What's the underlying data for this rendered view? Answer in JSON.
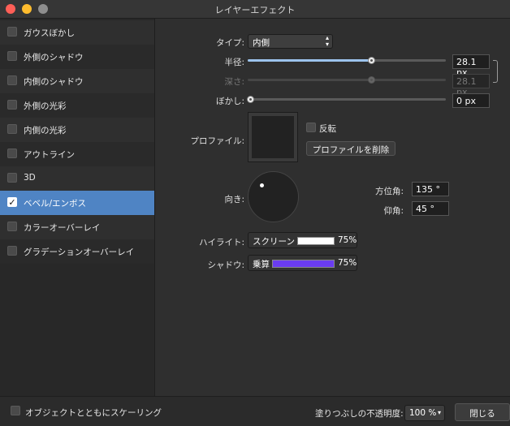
{
  "window": {
    "title": "レイヤーエフェクト"
  },
  "sidebar": {
    "items": [
      {
        "label": "ガウスぼかし",
        "checked": false
      },
      {
        "label": "外側のシャドウ",
        "checked": false
      },
      {
        "label": "内側のシャドウ",
        "checked": false
      },
      {
        "label": "外側の光彩",
        "checked": false
      },
      {
        "label": "内側の光彩",
        "checked": false
      },
      {
        "label": "アウトライン",
        "checked": false
      },
      {
        "label": "3D",
        "checked": false
      },
      {
        "label": "ベベル/エンボス",
        "checked": true
      },
      {
        "label": "カラーオーバーレイ",
        "checked": false
      },
      {
        "label": "グラデーションオーバーレイ",
        "checked": false
      }
    ]
  },
  "settings": {
    "type_label": "タイプ:",
    "type_value": "内側",
    "radius_label": "半径:",
    "radius_value": "28.1 px",
    "radius_fraction": 0.62,
    "depth_label": "深さ:",
    "depth_value": "28.1 px",
    "depth_fraction": 0.62,
    "blur_label": "ぼかし:",
    "blur_value": "0 px",
    "blur_fraction": 0.0,
    "profile_label": "プロファイル:",
    "invert_label": "反転",
    "delete_profile_label": "プロファイルを削除",
    "direction_label": "向き:",
    "azimuth_label": "方位角:",
    "azimuth_value": "135 °",
    "elevation_label": "仰角:",
    "elevation_value": "45 °",
    "highlight_label": "ハイライト:",
    "highlight_mode": "スクリーン",
    "highlight_color": "#ffffff",
    "highlight_opacity": "75%",
    "shadow_label": "シャドウ:",
    "shadow_mode": "乗算",
    "shadow_color": "#6a3cf0",
    "shadow_opacity": "75%"
  },
  "footer": {
    "scale_label": "オブジェクトとともにスケーリング",
    "opacity_label": "塗りつぶしの不透明度:",
    "opacity_value": "100 %",
    "close_label": "閉じる"
  }
}
